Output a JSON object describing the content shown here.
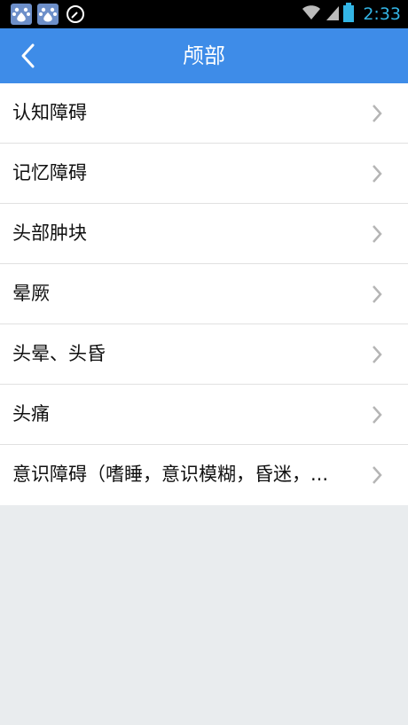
{
  "status_bar": {
    "time": "2:33",
    "left_icons": [
      "baidu-icon",
      "baidu-icon",
      "compass-icon"
    ],
    "right_icons": [
      "wifi-icon",
      "signal-icon",
      "battery-icon"
    ]
  },
  "header": {
    "title": "颅部",
    "back_icon": "chevron-left-icon",
    "background": "#3e8ce8"
  },
  "list": {
    "items": [
      {
        "label": "认知障碍"
      },
      {
        "label": "记忆障碍"
      },
      {
        "label": "头部肿块"
      },
      {
        "label": "晕厥"
      },
      {
        "label": "头晕、头昏"
      },
      {
        "label": "头痛"
      },
      {
        "label": "意识障碍（嗜睡，意识模糊，昏迷，..."
      }
    ]
  }
}
